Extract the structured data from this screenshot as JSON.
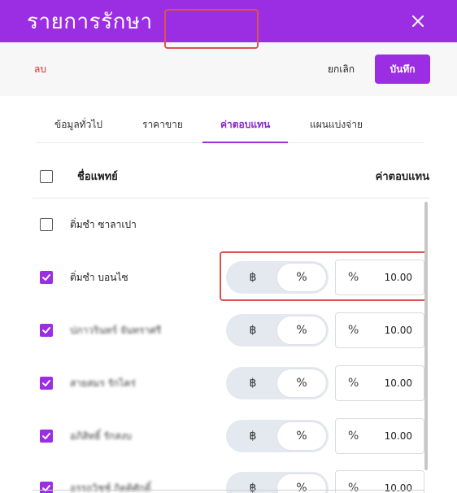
{
  "header": {
    "title": "รายการรักษา",
    "close_icon": "close-icon"
  },
  "toolbar": {
    "delete_label": "ลบ",
    "cancel_label": "ยกเลิก",
    "save_label": "บันทึก"
  },
  "tabs": [
    {
      "label": "ข้อมูลทั่วไป",
      "active": false
    },
    {
      "label": "ราคาขาย",
      "active": false
    },
    {
      "label": "ค่าตอบแทน",
      "active": true
    },
    {
      "label": "แผนแบ่งจ่าย",
      "active": false
    }
  ],
  "table": {
    "header": {
      "name": "ชื่อแพทย์",
      "commission": "ค่าตอบแทน"
    },
    "rows": [
      {
        "name": "ติ่มซำ ซาลาเปา",
        "checked": false
      },
      {
        "name": "ติ่มซำ บอนไซ",
        "checked": true,
        "mode": "%",
        "value": "10.00"
      },
      {
        "name": "ปภาวรินทร์ จันทราศรี",
        "checked": true,
        "mode": "%",
        "value": "10.00"
      },
      {
        "name": "สายสมร รักไคร่",
        "checked": true,
        "mode": "%",
        "value": "10.00"
      },
      {
        "name": "อภิสิทธิ์ รักสงบ",
        "checked": true,
        "mode": "%",
        "value": "10.00"
      },
      {
        "name": "อรรถวิชช์ กิตติศักดิ์",
        "checked": true,
        "mode": "%",
        "value": "10.00"
      }
    ]
  },
  "toggle": {
    "baht_symbol": "฿",
    "percent_symbol": "%"
  },
  "colors": {
    "brand": "#9b2ee3",
    "danger": "#d43030",
    "highlight": "#d9534f"
  }
}
